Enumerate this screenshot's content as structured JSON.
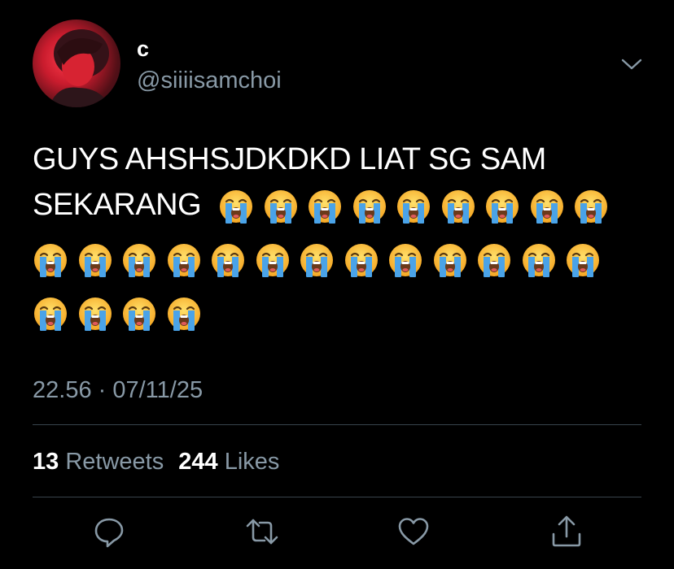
{
  "author": {
    "display_name": "c",
    "handle": "@siiiisamchoi"
  },
  "tweet": {
    "text": "GUYS AHSHSJDKDKD LIAT SG SAM SEKARANG",
    "emoji": "loudly-crying-face",
    "emoji_count": 26,
    "timestamp": "22.56 · 07/11/25"
  },
  "stats": {
    "retweets_count": "13",
    "retweets_label": "Retweets",
    "likes_count": "244",
    "likes_label": "Likes"
  },
  "actions": [
    "reply",
    "retweet",
    "like",
    "share"
  ],
  "colors": {
    "background": "#000000",
    "text": "#ffffff",
    "secondary": "#8899a6",
    "divider": "#38444d"
  }
}
